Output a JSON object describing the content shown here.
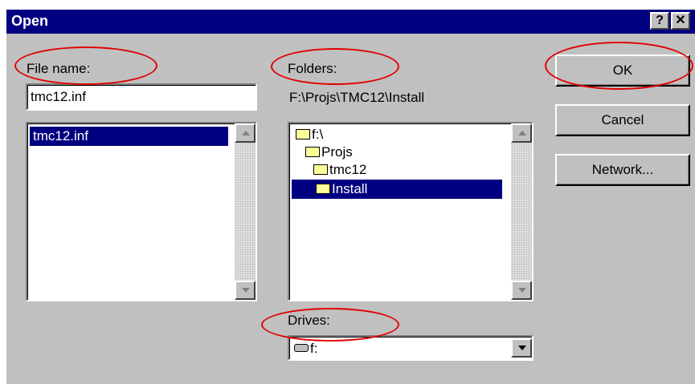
{
  "window": {
    "title": "Open",
    "help_label": "?",
    "close_label": "✕"
  },
  "file_name": {
    "label": "File name:",
    "value": "tmc12.inf",
    "list_items": [
      "tmc12.inf"
    ]
  },
  "folders": {
    "label": "Folders:",
    "current_path": "F:\\Projs\\TMC12\\Install",
    "tree": [
      {
        "label": "f:\\",
        "icon": "open-folder-icon",
        "selected": false
      },
      {
        "label": "Projs",
        "icon": "open-folder-icon",
        "selected": false
      },
      {
        "label": "tmc12",
        "icon": "open-folder-icon",
        "selected": false
      },
      {
        "label": "Install",
        "icon": "open-folder-icon",
        "selected": true
      }
    ]
  },
  "drives": {
    "label": "Drives:",
    "selected": "f:",
    "icon": "drive-icon"
  },
  "buttons": {
    "ok": "OK",
    "cancel": "Cancel",
    "network": "Network..."
  },
  "annotation_color": "#e00000"
}
